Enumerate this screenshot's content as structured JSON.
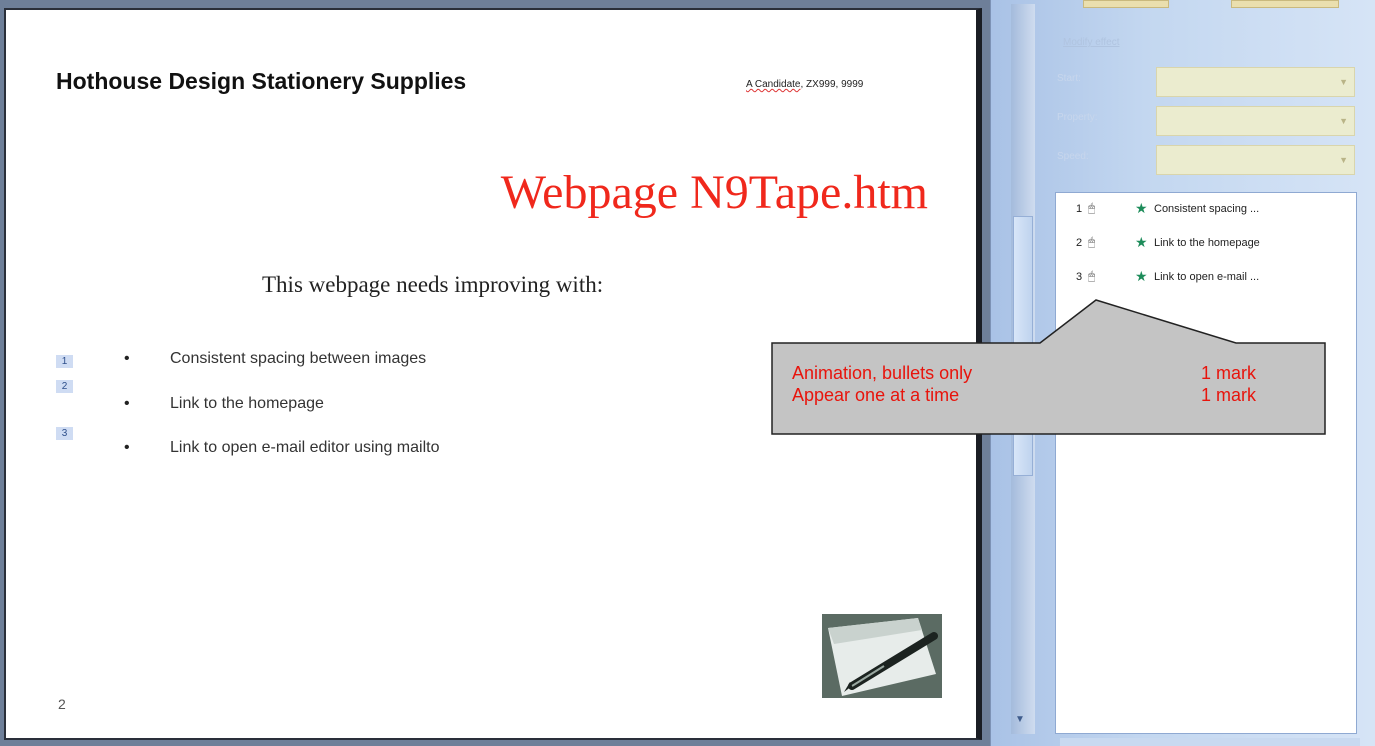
{
  "slide": {
    "title": "Hothouse Design Stationery Supplies",
    "candidate_prefix": "A Candidate",
    "candidate_rest": ", ZX999, 9999",
    "heading": "Webpage N9Tape.htm",
    "subheading": "This webpage needs improving with:",
    "animation_tags": [
      "1",
      "2",
      "3"
    ],
    "bullets": [
      "Consistent spacing between images",
      "Link to the homepage",
      "Link to open e-mail editor using mailto"
    ],
    "bullet_glyph": "•",
    "slide_number": "2",
    "image_icon": "pen-photo"
  },
  "callout": {
    "rows": [
      {
        "label": "Animation, bullets only",
        "mark": "1 mark"
      },
      {
        "label": "Appear one at a time",
        "mark": "1 mark"
      }
    ],
    "text_color": "#e8140c",
    "fill_color": "#c4c4c4"
  },
  "task_pane": {
    "section_label": "Modify effect",
    "fields": [
      {
        "label": "Start:",
        "value": ""
      },
      {
        "label": "Property:",
        "value": ""
      },
      {
        "label": "Speed:",
        "value": ""
      }
    ],
    "animation_items": [
      {
        "number": "1",
        "label": "Consistent spacing ..."
      },
      {
        "number": "2",
        "label": "Link to the homepage"
      },
      {
        "number": "3",
        "label": "Link to open e-mail ..."
      }
    ],
    "item_icons": [
      "mouse-icon",
      "entrance-star-icon"
    ],
    "accent_color": "#1d8c5a"
  }
}
